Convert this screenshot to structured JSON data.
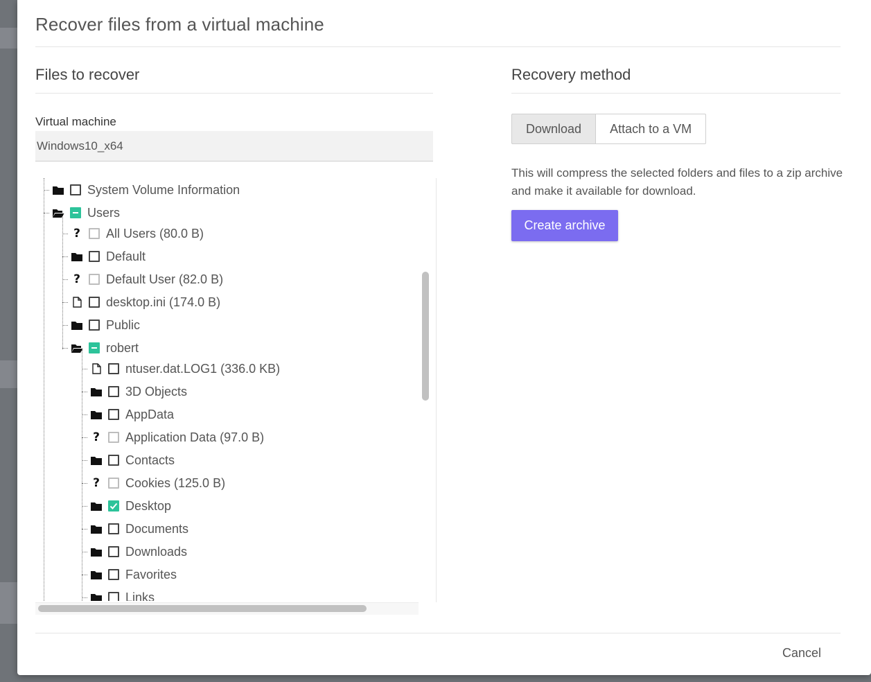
{
  "dialog": {
    "title": "Recover files from a virtual machine",
    "cancel_label": "Cancel"
  },
  "files_section": {
    "title": "Files to recover",
    "vm_label": "Virtual machine",
    "vm_value": "Windows10_x64"
  },
  "tree": [
    {
      "label": "System Volume Information",
      "icon": "folder-icon",
      "state": "unchecked",
      "level": 0
    },
    {
      "label": "Users",
      "icon": "folder-open-icon",
      "state": "partial",
      "level": 0
    },
    {
      "label": "All Users (80.0 B)",
      "icon": "question-icon",
      "state": "disabled",
      "level": 1
    },
    {
      "label": "Default",
      "icon": "folder-icon",
      "state": "unchecked",
      "level": 1
    },
    {
      "label": "Default User (82.0 B)",
      "icon": "question-icon",
      "state": "disabled",
      "level": 1
    },
    {
      "label": "desktop.ini (174.0 B)",
      "icon": "file-icon",
      "state": "unchecked",
      "level": 1
    },
    {
      "label": "Public",
      "icon": "folder-icon",
      "state": "unchecked",
      "level": 1
    },
    {
      "label": "robert",
      "icon": "folder-open-icon",
      "state": "partial",
      "level": 1
    },
    {
      "label": "ntuser.dat.LOG1 (336.0 KB)",
      "icon": "file-icon",
      "state": "unchecked",
      "level": 2
    },
    {
      "label": "3D Objects",
      "icon": "folder-icon",
      "state": "unchecked",
      "level": 2
    },
    {
      "label": "AppData",
      "icon": "folder-icon",
      "state": "unchecked",
      "level": 2
    },
    {
      "label": "Application Data (97.0 B)",
      "icon": "question-icon",
      "state": "disabled",
      "level": 2
    },
    {
      "label": "Contacts",
      "icon": "folder-icon",
      "state": "unchecked",
      "level": 2
    },
    {
      "label": "Cookies (125.0 B)",
      "icon": "question-icon",
      "state": "disabled",
      "level": 2
    },
    {
      "label": "Desktop",
      "icon": "folder-icon",
      "state": "checked",
      "level": 2
    },
    {
      "label": "Documents",
      "icon": "folder-icon",
      "state": "unchecked",
      "level": 2
    },
    {
      "label": "Downloads",
      "icon": "folder-icon",
      "state": "unchecked",
      "level": 2
    },
    {
      "label": "Favorites",
      "icon": "folder-icon",
      "state": "unchecked",
      "level": 2
    },
    {
      "label": "Links",
      "icon": "folder-icon",
      "state": "unchecked",
      "level": 2
    }
  ],
  "recovery_section": {
    "title": "Recovery method",
    "methods": [
      "Download",
      "Attach to a VM"
    ],
    "selected_method": "Download",
    "description": "This will compress the selected folders and files to a zip archive and make it available for download.",
    "create_label": "Create archive"
  },
  "colors": {
    "accent": "#7b6cf0",
    "check": "#2dc39a"
  }
}
